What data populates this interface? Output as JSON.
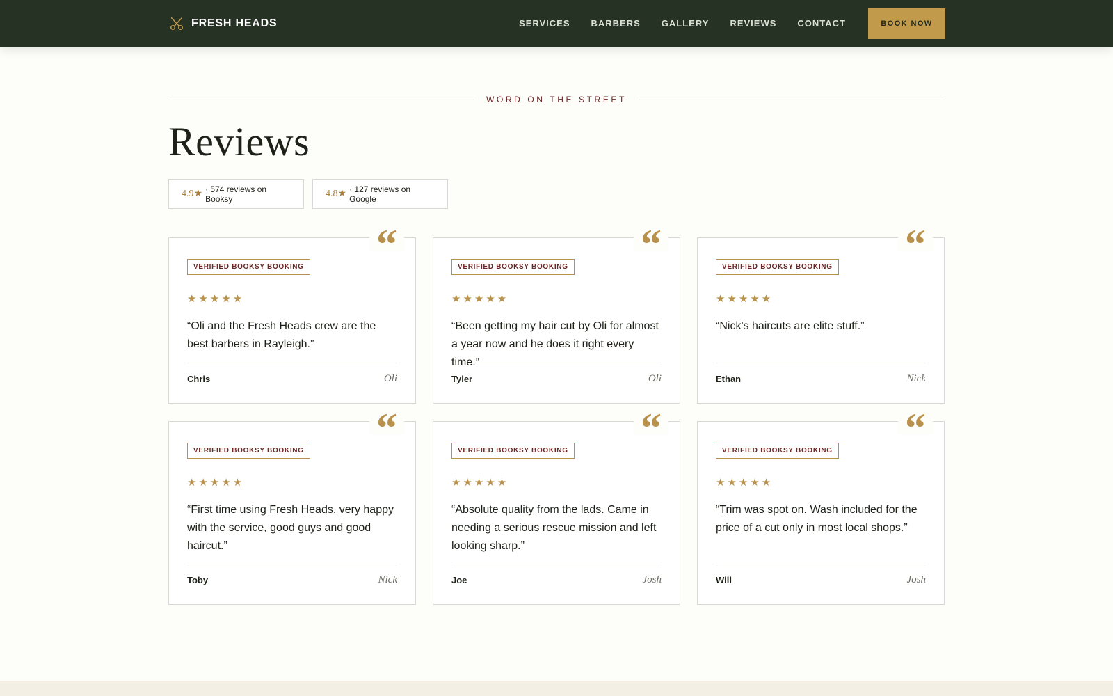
{
  "brand": {
    "name": "FRESH HEADS",
    "logo_icon": "scissors-icon"
  },
  "nav": {
    "links": [
      "SERVICES",
      "BARBERS",
      "GALLERY",
      "REVIEWS",
      "CONTACT"
    ],
    "cta_label": "BOOK NOW"
  },
  "section": {
    "eyebrow": "WORD ON THE STREET",
    "title": "Reviews"
  },
  "ratings": [
    {
      "score": "4.9★",
      "text": "· 574 reviews on Booksy"
    },
    {
      "score": "4.8★",
      "text": "· 127 reviews on Google"
    }
  ],
  "reviews": [
    {
      "badge": "VERIFIED BOOKSY BOOKING",
      "stars": "★★★★★",
      "rating": 5,
      "text": "“Oli and the Fresh Heads crew are the best barbers in Rayleigh.”",
      "reviewer": "Chris",
      "barber": "Oli",
      "quote_glyph": "“"
    },
    {
      "badge": "VERIFIED BOOKSY BOOKING",
      "stars": "★★★★★",
      "rating": 5,
      "text": "“Been getting my hair cut by Oli for almost a year now and he does it right every time.”",
      "reviewer": "Tyler",
      "barber": "Oli",
      "quote_glyph": "“"
    },
    {
      "badge": "VERIFIED BOOKSY BOOKING",
      "stars": "★★★★★",
      "rating": 5,
      "text": "“Nick's haircuts are elite stuff.”",
      "reviewer": "Ethan",
      "barber": "Nick",
      "quote_glyph": "“"
    },
    {
      "badge": "VERIFIED BOOKSY BOOKING",
      "stars": "★★★★★",
      "rating": 5,
      "text": "“First time using Fresh Heads, very happy with the service, good guys and good haircut.”",
      "reviewer": "Toby",
      "barber": "Nick",
      "quote_glyph": "“"
    },
    {
      "badge": "VERIFIED BOOKSY BOOKING",
      "stars": "★★★★★",
      "rating": 5,
      "text": "“Absolute quality from the lads. Came in needing a serious rescue mission and left looking sharp.”",
      "reviewer": "Joe",
      "barber": "Josh",
      "quote_glyph": "“"
    },
    {
      "badge": "VERIFIED BOOKSY BOOKING",
      "stars": "★★★★★",
      "rating": 5,
      "text": "“Trim was spot on. Wash included for the price of a cut only in most local shops.”",
      "reviewer": "Will",
      "barber": "Josh",
      "quote_glyph": "“"
    }
  ],
  "colors": {
    "nav_bg": "#263224",
    "accent_gold": "#c29a4b",
    "badge_text": "#6b2626",
    "page_bg": "#fdfdfa",
    "footer_band": "#f3efe4"
  }
}
